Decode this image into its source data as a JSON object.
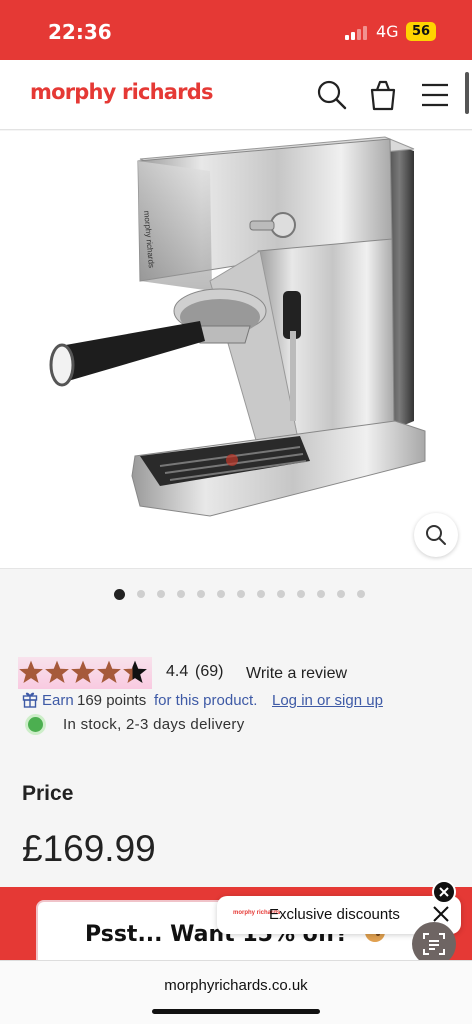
{
  "status_bar": {
    "time": "22:36",
    "network": "4G",
    "battery": "56"
  },
  "header": {
    "logo": "morphy richards",
    "icons": [
      "search-icon",
      "cart-icon",
      "menu-icon"
    ]
  },
  "product": {
    "image_brand_text": "morphy richards",
    "carousel": {
      "total": 13,
      "active_index": 0
    },
    "rating": {
      "value": "4.4",
      "count": "(69)",
      "stars_filled_fraction": 0.88,
      "write_review": "Write a review"
    },
    "points": {
      "earn": "Earn",
      "amount": "169 points",
      "for_text": "for this product.",
      "login_link": "Log in or sign up"
    },
    "stock": {
      "text": "In stock, 2-3 days delivery"
    },
    "price_label": "Price",
    "price": "£169.99"
  },
  "promo": {
    "banner_text": "Psst... Want 15% off?",
    "pill_brand": "morphy richards",
    "pill_text": "Exclusive discounts"
  },
  "url_bar": {
    "url": "morphyrichards.co.uk"
  },
  "colors": {
    "brand_red": "#e53935",
    "link_blue": "#3e5aa6",
    "star": "#a65a3a",
    "stock_green": "#4caf50"
  }
}
